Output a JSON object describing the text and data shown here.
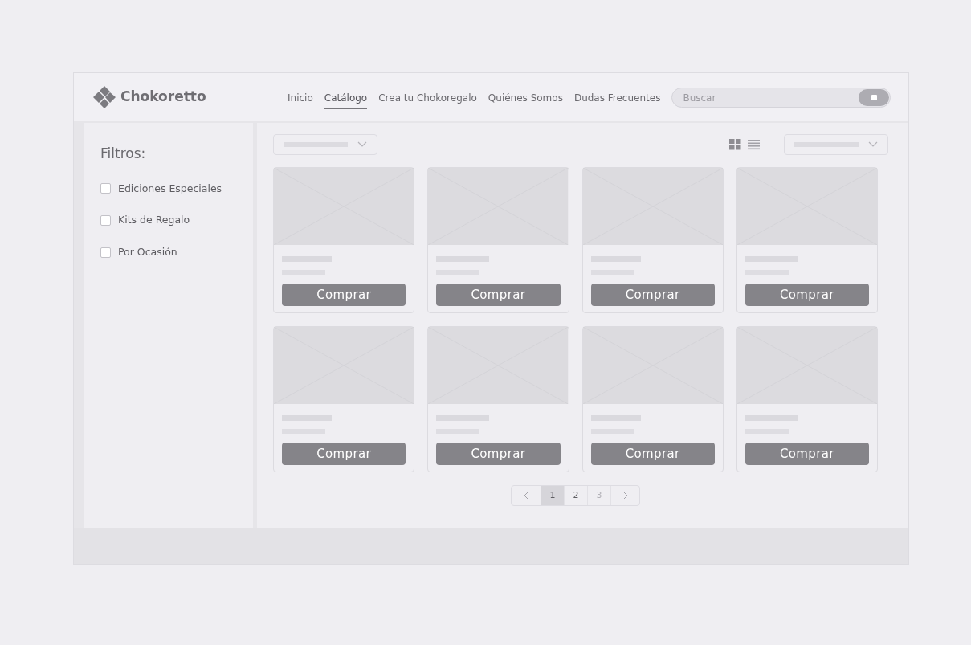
{
  "header": {
    "brand": "Chokoretto",
    "nav": [
      {
        "label": "Inicio",
        "selected": false
      },
      {
        "label": "Catálogo",
        "selected": true
      },
      {
        "label": "Crea tu Chokoregalo",
        "selected": false
      },
      {
        "label": "Quiénes Somos",
        "selected": false
      },
      {
        "label": "Dudas Frecuentes",
        "selected": false
      }
    ],
    "search": {
      "placeholder": "Buscar"
    }
  },
  "sidebar": {
    "title": "Filtros:",
    "filters": [
      {
        "label": "Ediciones Especiales",
        "checked": false
      },
      {
        "label": "Kits de Regalo",
        "checked": false
      },
      {
        "label": "Por Ocasión",
        "checked": false
      }
    ]
  },
  "toolbar": {
    "views": [
      {
        "kind": "grid",
        "selected": true
      },
      {
        "kind": "list",
        "selected": false
      }
    ]
  },
  "products": [
    {
      "button": "Comprar"
    },
    {
      "button": "Comprar"
    },
    {
      "button": "Comprar"
    },
    {
      "button": "Comprar"
    },
    {
      "button": "Comprar"
    },
    {
      "button": "Comprar"
    },
    {
      "button": "Comprar"
    },
    {
      "button": "Comprar"
    }
  ],
  "pagination": {
    "pages": [
      {
        "label": "1",
        "selected": true,
        "disabled": false
      },
      {
        "label": "2",
        "selected": false,
        "disabled": false
      },
      {
        "label": "3",
        "selected": false,
        "disabled": true
      }
    ]
  }
}
